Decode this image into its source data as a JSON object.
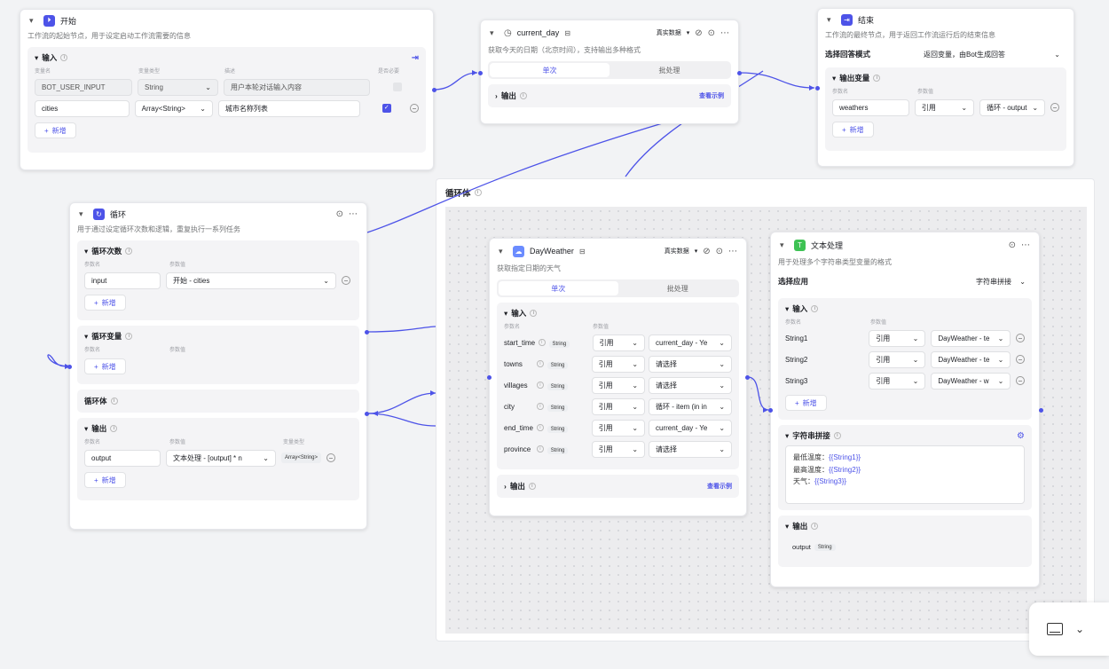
{
  "start": {
    "title": "开始",
    "desc": "工作流的起始节点，用于设定启动工作流需要的信息",
    "input_section": "输入",
    "col_name": "变量名",
    "col_type": "变量类型",
    "col_desc": "描述",
    "col_required": "是否必要",
    "rows": [
      {
        "name": "BOT_USER_INPUT",
        "type": "String",
        "desc": "用户本轮对话输入内容"
      },
      {
        "name": "cities",
        "type": "Array<String>",
        "desc": "城市名称列表"
      }
    ],
    "add": "新增"
  },
  "current_day": {
    "title": "current_day",
    "mode": "真实数据",
    "desc": "获取今天的日期（北京时间），支持输出多种格式",
    "tab_single": "单次",
    "tab_batch": "批处理",
    "output": "输出",
    "example": "查看示例"
  },
  "end": {
    "title": "结束",
    "desc": "工作流的最终节点，用于返回工作流运行后的结束信息",
    "answer_mode_label": "选择回答模式",
    "answer_mode_value": "返回变量，由Bot生成回答",
    "output_section": "输出变量",
    "col_name": "参数名",
    "col_value": "参数值",
    "var_name": "weathers",
    "ref": "引用",
    "ref_value": "循环 - output",
    "add": "新增"
  },
  "loop": {
    "title": "循环",
    "desc": "用于通过设定循环次数和逻辑，重复执行一系列任务",
    "count_section": "循环次数",
    "col_name": "参数名",
    "col_value": "参数值",
    "col_type": "变量类型",
    "count_name": "input",
    "count_value": "开始 - cities",
    "var_section": "循环变量",
    "body_label": "循环体",
    "output_section": "输出",
    "out_name": "output",
    "out_value": "文本处理 - [output] * n",
    "out_type": "Array<String>",
    "add": "新增"
  },
  "loop_body": {
    "title": "循环体"
  },
  "dayweather": {
    "title": "DayWeather",
    "mode": "真实数据",
    "desc": "获取指定日期的天气",
    "tab_single": "单次",
    "tab_batch": "批处理",
    "input_section": "输入",
    "col_name": "参数名",
    "col_value": "参数值",
    "params": [
      {
        "name": "start_time",
        "type": "String",
        "ref": "引用",
        "value": "current_day - Ye"
      },
      {
        "name": "towns",
        "type": "String",
        "ref": "引用",
        "value": "请选择"
      },
      {
        "name": "villages",
        "type": "String",
        "ref": "引用",
        "value": "请选择"
      },
      {
        "name": "city",
        "type": "String",
        "ref": "引用",
        "value": "循环 - item (in in"
      },
      {
        "name": "end_time",
        "type": "String",
        "ref": "引用",
        "value": "current_day - Ye"
      },
      {
        "name": "province",
        "type": "String",
        "ref": "引用",
        "value": "请选择"
      }
    ],
    "output": "输出",
    "example": "查看示例"
  },
  "textproc": {
    "title": "文本处理",
    "desc": "用于处理多个字符串类型变量的格式",
    "app_label": "选择应用",
    "app_value": "字符串拼接",
    "input_section": "输入",
    "col_name": "参数名",
    "col_value": "参数值",
    "params": [
      {
        "name": "String1",
        "ref": "引用",
        "value": "DayWeather - te"
      },
      {
        "name": "String2",
        "ref": "引用",
        "value": "DayWeather - te"
      },
      {
        "name": "String3",
        "ref": "引用",
        "value": "DayWeather - w"
      }
    ],
    "add": "新增",
    "concat_section": "字符串拼接",
    "tmpl": [
      {
        "label": "最低温度：",
        "var": "{{String1}}"
      },
      {
        "label": "最高温度：",
        "var": "{{String2}}"
      },
      {
        "label": "天气：",
        "var": "{{String3}}"
      }
    ],
    "output_section": "输出",
    "out_name": "output",
    "out_type": "String"
  },
  "colors": {
    "accent": "#4d53e8",
    "canvas": "#f2f3f5"
  }
}
